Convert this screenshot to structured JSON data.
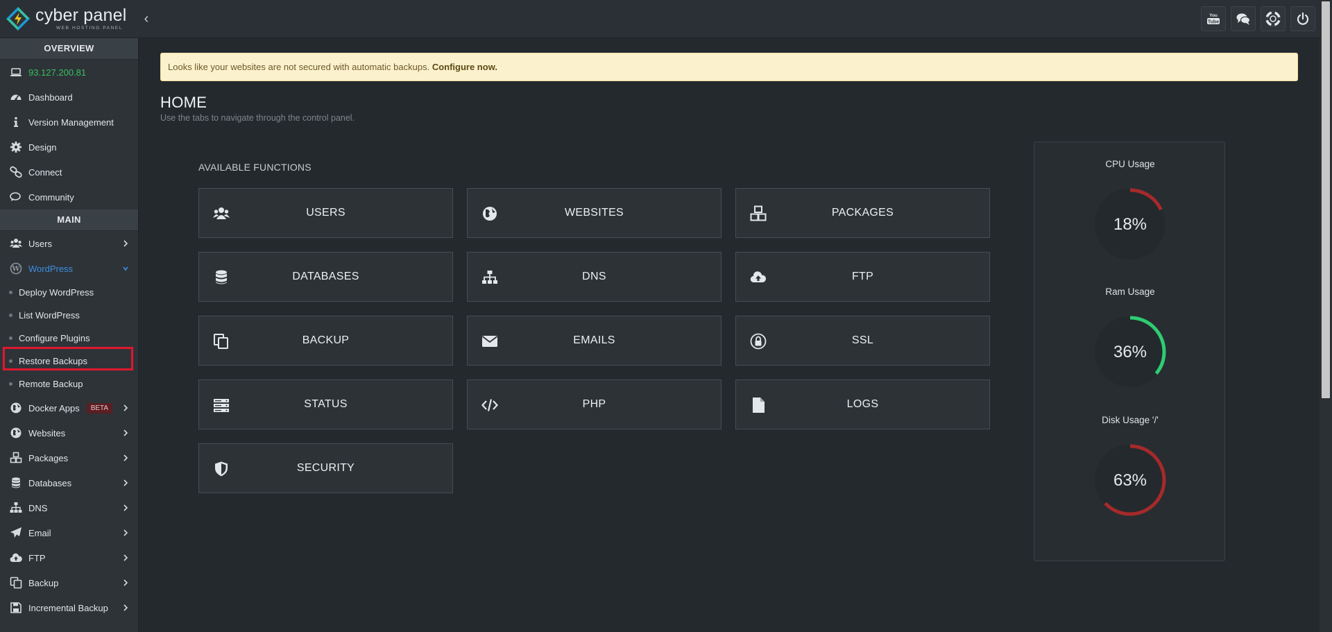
{
  "app": {
    "logo_name": "cyber panel",
    "logo_subtitle": "WEB HOSTING PANEL",
    "collapse_glyph": "‹"
  },
  "header_icons": [
    {
      "name": "youtube-icon"
    },
    {
      "name": "chat-icon"
    },
    {
      "name": "support-lifebuoy-icon"
    },
    {
      "name": "power-icon"
    }
  ],
  "sidebar": {
    "overview_heading": "OVERVIEW",
    "ip": "93.127.200.81",
    "overview_items": [
      {
        "label": "Dashboard",
        "icon": "dashboard-icon"
      },
      {
        "label": "Version Management",
        "icon": "info-icon"
      },
      {
        "label": "Design",
        "icon": "gear-icon"
      },
      {
        "label": "Connect",
        "icon": "link-icon"
      },
      {
        "label": "Community",
        "icon": "comments-icon"
      }
    ],
    "main_heading": "MAIN",
    "users": "Users",
    "wordpress": "WordPress",
    "wordpress_sub": [
      "Deploy WordPress",
      "List WordPress",
      "Configure Plugins",
      "Restore Backups",
      "Remote Backup"
    ],
    "docker": "Docker Apps",
    "docker_badge": "BETA",
    "main_items": [
      {
        "label": "Websites",
        "icon": "globe-icon"
      },
      {
        "label": "Packages",
        "icon": "cubes-icon"
      },
      {
        "label": "Databases",
        "icon": "database-icon"
      },
      {
        "label": "DNS",
        "icon": "sitemap-icon"
      },
      {
        "label": "Email",
        "icon": "paper-plane-icon"
      },
      {
        "label": "FTP",
        "icon": "cloud-upload-icon"
      },
      {
        "label": "Backup",
        "icon": "copy-icon"
      },
      {
        "label": "Incremental Backup",
        "icon": "save-icon"
      }
    ]
  },
  "alert": {
    "text": "Looks like your websites are not secured with automatic backups. ",
    "link": "Configure now."
  },
  "page": {
    "title": "HOME",
    "subtitle": "Use the tabs to navigate through the control panel.",
    "functions_heading": "AVAILABLE FUNCTIONS"
  },
  "functions": [
    {
      "label": "USERS",
      "icon": "users-icon"
    },
    {
      "label": "WEBSITES",
      "icon": "globe-icon"
    },
    {
      "label": "PACKAGES",
      "icon": "cubes-icon"
    },
    {
      "label": "DATABASES",
      "icon": "database-icon"
    },
    {
      "label": "DNS",
      "icon": "sitemap-icon"
    },
    {
      "label": "FTP",
      "icon": "cloud-upload-icon"
    },
    {
      "label": "BACKUP",
      "icon": "copy-icon"
    },
    {
      "label": "EMAILS",
      "icon": "envelope-icon"
    },
    {
      "label": "SSL",
      "icon": "lock-icon"
    },
    {
      "label": "STATUS",
      "icon": "server-icon"
    },
    {
      "label": "PHP",
      "icon": "code-icon"
    },
    {
      "label": "LOGS",
      "icon": "file-icon"
    },
    {
      "label": "SECURITY",
      "icon": "shield-icon"
    }
  ],
  "usage": [
    {
      "title": "CPU Usage",
      "value": "18%",
      "percent": 18,
      "color": "#a52a2a"
    },
    {
      "title": "Ram Usage",
      "value": "36%",
      "percent": 36,
      "color": "#2ecc71"
    },
    {
      "title": "Disk Usage '/'",
      "value": "63%",
      "percent": 63,
      "color": "#a52a2a"
    }
  ],
  "colors": {
    "accent_blue": "#3c8fe0",
    "ip_green": "#37c15f",
    "highlight_red": "#e0182d"
  }
}
